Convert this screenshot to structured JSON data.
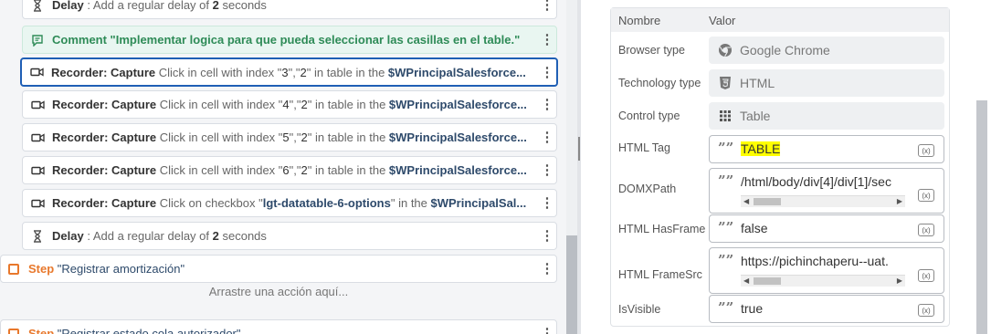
{
  "flow": {
    "rows": [
      {
        "kind": "delay",
        "parts": [
          {
            "t": "Delay",
            "c": "b"
          },
          {
            "t": " : Add a regular delay of ",
            "c": "g"
          },
          {
            "t": "2",
            "c": "b"
          },
          {
            "t": " seconds",
            "c": "g"
          }
        ]
      },
      {
        "kind": "comment",
        "text": "Comment \"Implementar logica para que pueda seleccionar las casillas en el table.\""
      },
      {
        "kind": "recorder",
        "selected": true,
        "parts": [
          {
            "t": "Recorder: Capture",
            "c": "b"
          },
          {
            "t": " Click in cell with index \"",
            "c": "g"
          },
          {
            "t": "3",
            "c": "dk"
          },
          {
            "t": "\",\"",
            "c": "g"
          },
          {
            "t": "2",
            "c": "dk"
          },
          {
            "t": "\" in table in the ",
            "c": "g"
          },
          {
            "t": "$WPrincipalSalesforce...",
            "c": "bl"
          }
        ]
      },
      {
        "kind": "recorder",
        "parts": [
          {
            "t": "Recorder: Capture",
            "c": "b"
          },
          {
            "t": " Click in cell with index \"",
            "c": "g"
          },
          {
            "t": "4",
            "c": "dk"
          },
          {
            "t": "\",\"",
            "c": "g"
          },
          {
            "t": "2",
            "c": "dk"
          },
          {
            "t": "\" in table in the ",
            "c": "g"
          },
          {
            "t": "$WPrincipalSalesforce...",
            "c": "bl"
          }
        ]
      },
      {
        "kind": "recorder",
        "parts": [
          {
            "t": "Recorder: Capture",
            "c": "b"
          },
          {
            "t": " Click in cell with index \"",
            "c": "g"
          },
          {
            "t": "5",
            "c": "dk"
          },
          {
            "t": "\",\"",
            "c": "g"
          },
          {
            "t": "2",
            "c": "dk"
          },
          {
            "t": "\" in table in the ",
            "c": "g"
          },
          {
            "t": "$WPrincipalSalesforce...",
            "c": "bl"
          }
        ]
      },
      {
        "kind": "recorder",
        "parts": [
          {
            "t": "Recorder: Capture",
            "c": "b"
          },
          {
            "t": " Click in cell with index \"",
            "c": "g"
          },
          {
            "t": "6",
            "c": "dk"
          },
          {
            "t": "\",\"",
            "c": "g"
          },
          {
            "t": "2",
            "c": "dk"
          },
          {
            "t": "\" in table in the ",
            "c": "g"
          },
          {
            "t": "$WPrincipalSalesforce...",
            "c": "bl"
          }
        ]
      },
      {
        "kind": "recorder",
        "parts": [
          {
            "t": "Recorder: Capture",
            "c": "b"
          },
          {
            "t": " Click on checkbox \"",
            "c": "g"
          },
          {
            "t": "lgt-datatable-6-options",
            "c": "bl"
          },
          {
            "t": "\" in the ",
            "c": "g"
          },
          {
            "t": "$WPrincipalSal...",
            "c": "bl"
          }
        ]
      },
      {
        "kind": "delay",
        "parts": [
          {
            "t": "Delay",
            "c": "b"
          },
          {
            "t": " : Add a regular delay of ",
            "c": "g"
          },
          {
            "t": "2",
            "c": "b"
          },
          {
            "t": " seconds",
            "c": "g"
          }
        ]
      }
    ],
    "step1": {
      "label": "Step",
      "name": " \"Registrar amortización\""
    },
    "drop_hint": "Arrastre una acción aquí...",
    "step2": {
      "label": "Step",
      "name": " \"Registrar estado cola autorizador\""
    },
    "menu_glyph": "⋮"
  },
  "props": {
    "col_name": "Nombre",
    "col_value": "Valor",
    "rows": [
      {
        "label": "Browser type",
        "value": "Google Chrome",
        "icon": "chrome-icon",
        "kind": "ro"
      },
      {
        "label": "Technology type",
        "value": "HTML",
        "icon": "html5-icon",
        "kind": "ro"
      },
      {
        "label": "Control type",
        "value": "Table",
        "icon": "table-grid-icon",
        "kind": "ro"
      },
      {
        "label": "HTML Tag",
        "value": "TABLE",
        "kind": "ed",
        "highlight": true
      },
      {
        "label": "DOMXPath",
        "value": "/html/body/div[4]/div[1]/sec",
        "kind": "ed",
        "scroll": true
      },
      {
        "label": "HTML HasFrame",
        "value": "false",
        "kind": "ed"
      },
      {
        "label": "HTML FrameSrc",
        "value": "https://pichinchaperu--uat.",
        "kind": "ed",
        "scroll": true
      },
      {
        "label": "IsVisible",
        "value": "true",
        "kind": "ed"
      }
    ],
    "var_btn": "(x)",
    "quote_glyph": "”"
  },
  "colors": {
    "accent": "#1f5fb5",
    "step": "#e8782c",
    "comment": "#2e8b57",
    "highlight": "#ffff00"
  }
}
